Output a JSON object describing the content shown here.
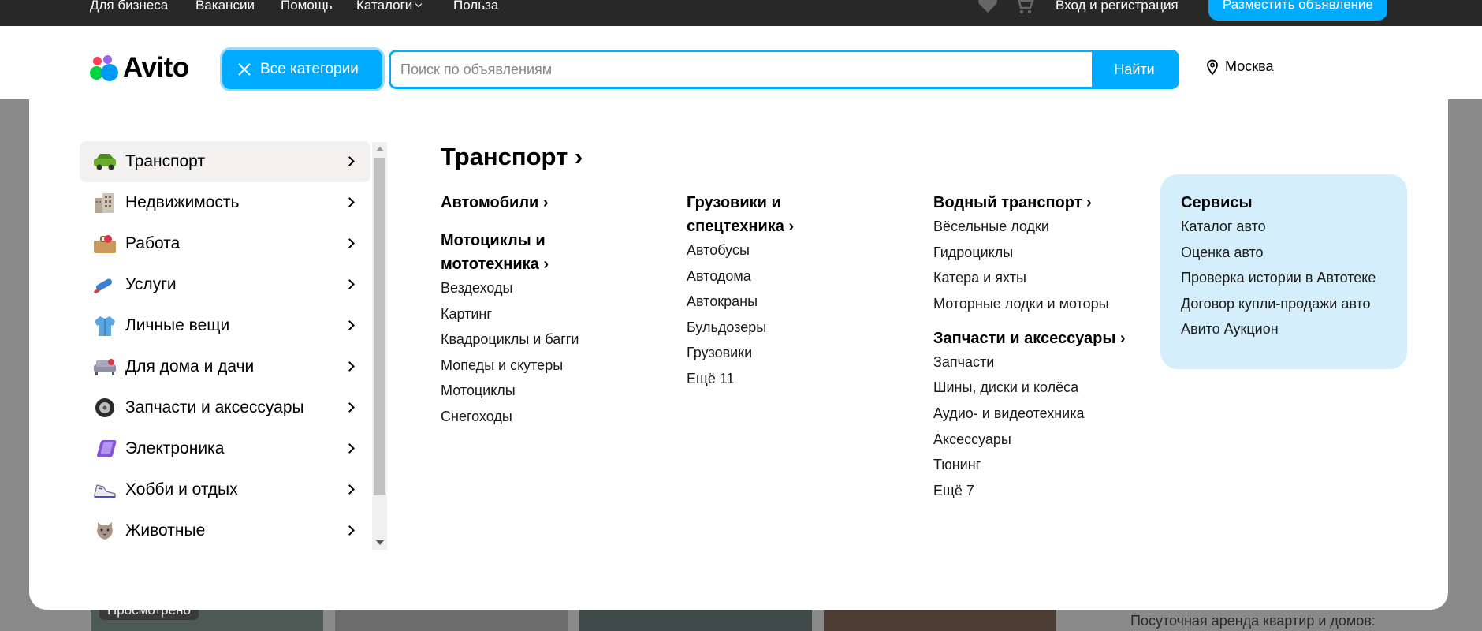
{
  "topbar": {
    "links": [
      "Для бизнеса",
      "Вакансии",
      "Помощь",
      "Каталоги",
      "Польза"
    ],
    "login": "Вход и регистрация",
    "post_ad": "Разместить объявление"
  },
  "header": {
    "logo": "Avito",
    "all_categories": "Все категории",
    "search_placeholder": "Поиск по объявлениям",
    "search_button": "Найти",
    "city": "Москва"
  },
  "categories": [
    {
      "label": "Транспорт",
      "icon": "car-icon"
    },
    {
      "label": "Недвижимость",
      "icon": "building-icon"
    },
    {
      "label": "Работа",
      "icon": "briefcase-icon"
    },
    {
      "label": "Услуги",
      "icon": "paint-roller-icon"
    },
    {
      "label": "Личные вещи",
      "icon": "jacket-icon"
    },
    {
      "label": "Для дома и дачи",
      "icon": "sofa-icon"
    },
    {
      "label": "Запчасти и аксессуары",
      "icon": "tire-icon"
    },
    {
      "label": "Электроника",
      "icon": "tablet-icon"
    },
    {
      "label": "Хобби и отдых",
      "icon": "sneaker-icon"
    },
    {
      "label": "Животные",
      "icon": "cat-icon"
    }
  ],
  "section": {
    "title": "Транспорт",
    "col1": {
      "g1_title": "Автомобили",
      "g2_title_line1": "Мотоциклы и",
      "g2_title_line2": "мототехника",
      "g2_items": [
        "Вездеходы",
        "Картинг",
        "Квадроциклы и багги",
        "Мопеды и скутеры",
        "Мотоциклы",
        "Снегоходы"
      ]
    },
    "col2": {
      "g1_title_line1": "Грузовики и",
      "g1_title_line2": "спецтехника",
      "g1_items": [
        "Автобусы",
        "Автодома",
        "Автокраны",
        "Бульдозеры",
        "Грузовики",
        "Ещё 11"
      ]
    },
    "col3": {
      "g1_title": "Водный транспорт",
      "g1_items": [
        "Вёсельные лодки",
        "Гидроциклы",
        "Катера и яхты",
        "Моторные лодки и моторы"
      ],
      "g2_title": "Запчасти и аксессуары",
      "g2_items": [
        "Запчасти",
        "Шины, диски и колёса",
        "Аудио- и видеотехника",
        "Аксессуары",
        "Тюнинг",
        "Ещё 7"
      ]
    },
    "services": {
      "title": "Сервисы",
      "items": [
        "Каталог авто",
        "Оценка авто",
        "Проверка истории в Автотеке",
        "Договор купли-продажи авто",
        "Авито Аукцион"
      ]
    }
  },
  "background": {
    "viewed_badge": "Просмотрено",
    "daily_rent": "Посуточная аренда квартир и домов:"
  },
  "colors": {
    "accent": "#00aaff",
    "topbar": "#282828",
    "services_bg": "#d4eefb"
  }
}
